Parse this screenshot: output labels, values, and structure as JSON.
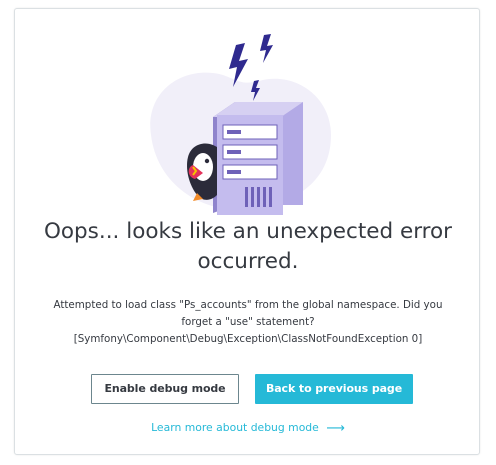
{
  "title": {
    "line1": "Oops... looks like an unexpected error",
    "line2": "occurred."
  },
  "message": {
    "line1": "Attempted to load class \"Ps_accounts\" from the global namespace. Did you",
    "line2": "forget a \"use\" statement?",
    "line3": "[Symfony\\Component\\Debug\\Exception\\ClassNotFoundException 0]"
  },
  "actions": {
    "debug_label": "Enable debug mode",
    "back_label": "Back to previous page",
    "learn_label": "Learn more about debug mode",
    "learn_icon": "arrow-right-icon"
  },
  "colors": {
    "accent": "#25b9d7",
    "text": "#363a41",
    "server": "#b7aee6",
    "lightning": "#3a2aa8"
  },
  "illustration_icon": "server-with-lightning-and-puffin-mascot"
}
